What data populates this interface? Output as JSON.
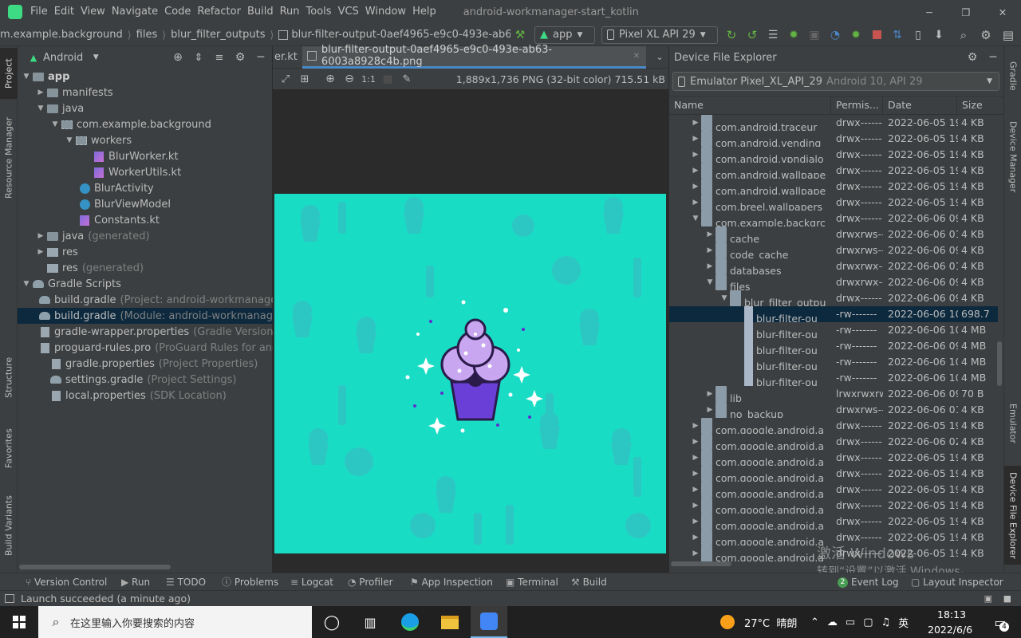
{
  "menubar": {
    "items": [
      "File",
      "Edit",
      "View",
      "Navigate",
      "Code",
      "Refactor",
      "Build",
      "Run",
      "Tools",
      "VCS",
      "Window",
      "Help"
    ],
    "window_title": "android-workmanager-start_kotlin"
  },
  "navbar": {
    "crumbs": [
      "m.example.background",
      "files",
      "blur_filter_outputs",
      "blur-filter-output-0aef4965-e9c0-493e-ab63-6003..."
    ],
    "run_config": "app",
    "device": "Pixel XL API 29"
  },
  "project": {
    "view_label": "Android",
    "tree": [
      {
        "label": "app",
        "hint": ""
      },
      {
        "label": "manifests",
        "hint": ""
      },
      {
        "label": "java",
        "hint": ""
      },
      {
        "label": "com.example.background",
        "hint": ""
      },
      {
        "label": "workers",
        "hint": ""
      },
      {
        "label": "BlurWorker.kt",
        "hint": ""
      },
      {
        "label": "WorkerUtils.kt",
        "hint": ""
      },
      {
        "label": "BlurActivity",
        "hint": ""
      },
      {
        "label": "BlurViewModel",
        "hint": ""
      },
      {
        "label": "Constants.kt",
        "hint": ""
      },
      {
        "label": "java",
        "hint": "(generated)"
      },
      {
        "label": "res",
        "hint": ""
      },
      {
        "label": "res",
        "hint": "(generated)"
      },
      {
        "label": "Gradle Scripts",
        "hint": ""
      },
      {
        "label": "build.gradle",
        "hint": "(Project: android-workmanager"
      },
      {
        "label": "build.gradle",
        "hint": "(Module: android-workmanage"
      },
      {
        "label": "gradle-wrapper.properties",
        "hint": "(Gradle Version)"
      },
      {
        "label": "proguard-rules.pro",
        "hint": "(ProGuard Rules for and"
      },
      {
        "label": "gradle.properties",
        "hint": "(Project Properties)"
      },
      {
        "label": "settings.gradle",
        "hint": "(Project Settings)"
      },
      {
        "label": "local.properties",
        "hint": "(SDK Location)"
      }
    ]
  },
  "editor": {
    "tab_prev": "er.kt",
    "tab_active": "blur-filter-output-0aef4965-e9c0-493e-ab63-6003a8928c4b.png",
    "zoom_label": "1:1",
    "image_info": "1,889x1,736 PNG (32-bit color) 715.51 kB"
  },
  "dfe": {
    "title": "Device File Explorer",
    "device_name": "Emulator Pixel_XL_API_29",
    "device_detail": "Android 10, API 29",
    "columns": {
      "name": "Name",
      "perm": "Permis...",
      "date": "Date",
      "size": "Size"
    },
    "rows": [
      {
        "name": "com.android.traceur",
        "perm": "drwx------",
        "date": "2022-06-05 19:",
        "size": "4 KB"
      },
      {
        "name": "com.android.vending",
        "perm": "drwx------",
        "date": "2022-06-05 19:",
        "size": "4 KB"
      },
      {
        "name": "com.android.vpndialo",
        "perm": "drwx------",
        "date": "2022-06-05 19:",
        "size": "4 KB"
      },
      {
        "name": "com.android.wallpape",
        "perm": "drwx------",
        "date": "2022-06-05 19:",
        "size": "4 KB"
      },
      {
        "name": "com.android.wallpape",
        "perm": "drwx------",
        "date": "2022-06-05 19:",
        "size": "4 KB"
      },
      {
        "name": "com.breel.wallpapers",
        "perm": "drwx------",
        "date": "2022-06-05 19:",
        "size": "4 KB"
      },
      {
        "name": "com.example.backgrc",
        "perm": "drwx------",
        "date": "2022-06-06 09:",
        "size": "4 KB"
      },
      {
        "name": "cache",
        "perm": "drwxrws--",
        "date": "2022-06-06 01:",
        "size": "4 KB"
      },
      {
        "name": "code_cache",
        "perm": "drwxrws--",
        "date": "2022-06-06 09:",
        "size": "4 KB"
      },
      {
        "name": "databases",
        "perm": "drwxrwx--",
        "date": "2022-06-06 01:",
        "size": "4 KB"
      },
      {
        "name": "files",
        "perm": "drwxrwx--",
        "date": "2022-06-06 09:",
        "size": "4 KB"
      },
      {
        "name": "blur_filter_outpu",
        "perm": "drwx------",
        "date": "2022-06-06 09:",
        "size": "4 KB"
      },
      {
        "name": "blur-filter-ou",
        "perm": "-rw-------",
        "date": "2022-06-06 10:",
        "size": "698.7"
      },
      {
        "name": "blur-filter-ou",
        "perm": "-rw-------",
        "date": "2022-06-06 10:",
        "size": "4 MB"
      },
      {
        "name": "blur-filter-ou",
        "perm": "-rw-------",
        "date": "2022-06-06 09:",
        "size": "4 MB"
      },
      {
        "name": "blur-filter-ou",
        "perm": "-rw-------",
        "date": "2022-06-06 10:",
        "size": "4 MB"
      },
      {
        "name": "blur-filter-ou",
        "perm": "-rw-------",
        "date": "2022-06-06 10:",
        "size": "4 MB"
      },
      {
        "name": "lib",
        "perm": "lrwxrwxrw",
        "date": "2022-06-06 09:",
        "size": "70 B"
      },
      {
        "name": "no_backup",
        "perm": "drwxrws--",
        "date": "2022-06-06 01:",
        "size": "4 KB"
      },
      {
        "name": "com.google.android.a",
        "perm": "drwx------",
        "date": "2022-06-05 19:",
        "size": "4 KB"
      },
      {
        "name": "com.google.android.a",
        "perm": "drwx------",
        "date": "2022-06-06 02:",
        "size": "4 KB"
      },
      {
        "name": "com.google.android.a",
        "perm": "drwx------",
        "date": "2022-06-05 19:",
        "size": "4 KB"
      },
      {
        "name": "com.google.android.a",
        "perm": "drwx------",
        "date": "2022-06-05 19:",
        "size": "4 KB"
      },
      {
        "name": "com.google.android.a",
        "perm": "drwx------",
        "date": "2022-06-05 19:",
        "size": "4 KB"
      },
      {
        "name": "com.google.android.a",
        "perm": "drwx------",
        "date": "2022-06-05 19:",
        "size": "4 KB"
      },
      {
        "name": "com.google.android.a",
        "perm": "drwx------",
        "date": "2022-06-05 19:",
        "size": "4 KB"
      },
      {
        "name": "com.google.android.a",
        "perm": "drwx------",
        "date": "2022-06-05 19:",
        "size": "4 KB"
      },
      {
        "name": "com.google.android.a",
        "perm": "drwx------",
        "date": "2022-06-05 19:",
        "size": "4 KB"
      }
    ]
  },
  "sidetabs": {
    "left": [
      "Project",
      "Resource Manager",
      "Structure",
      "Favorites",
      "Build Variants"
    ],
    "right": [
      "Gradle",
      "Device Manager",
      "Emulator",
      "Device File Explorer"
    ]
  },
  "bottom": {
    "tabs": [
      "Version Control",
      "Run",
      "TODO",
      "Problems",
      "Logcat",
      "Profiler",
      "App Inspection",
      "Terminal",
      "Build"
    ],
    "event_log": "Event Log",
    "event_count": "2",
    "layout_inspector": "Layout Inspector"
  },
  "status": {
    "message": "Launch succeeded (a minute ago)"
  },
  "watermark": {
    "line1": "激活 Windows",
    "line2": "转到“设置”以激活 Windows。"
  },
  "taskbar": {
    "search_placeholder": "在这里输入你要搜索的内容",
    "weather": "27°C  晴朗",
    "ime": "英",
    "time": "18:13",
    "date": "2022/6/6",
    "notif_count": "4"
  },
  "colors": {
    "accent": "#4a88c7",
    "selection": "#0d293e",
    "image_bg": "#19dcc4",
    "cupcake_frosting": "#c9a6f0",
    "cupcake_cup": "#6a3fd8"
  }
}
